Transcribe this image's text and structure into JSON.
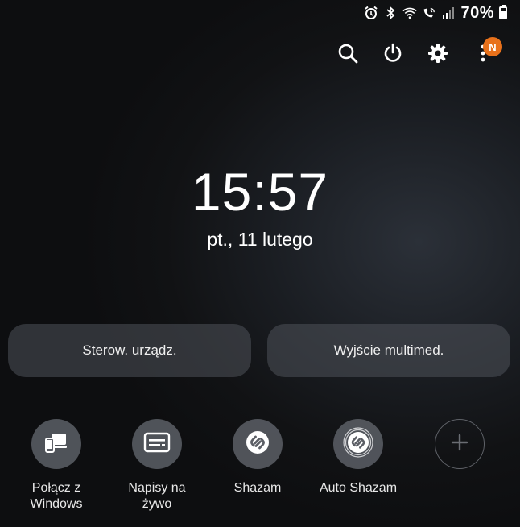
{
  "status_bar": {
    "icons": [
      "alarm-icon",
      "bluetooth-icon",
      "wifi-icon",
      "wifi-calling-icon",
      "signal-icon"
    ],
    "battery_text": "70%",
    "battery_level": 0.7
  },
  "top_actions": {
    "icons": [
      "search-icon",
      "power-icon",
      "gear-icon",
      "more-vertical-icon"
    ],
    "badge": "N",
    "badge_color": "#e8711b"
  },
  "clock": {
    "time": "15:57",
    "date": "pt., 11 lutego"
  },
  "buttons": {
    "device_control": "Sterow. urządz.",
    "media_output": "Wyjście multimed."
  },
  "tiles": {
    "link_windows_1": "Połącz z",
    "link_windows_2": "Windows",
    "live_caption_1": "Napisy na",
    "live_caption_2": "żywo",
    "shazam": "Shazam",
    "auto_shazam": "Auto Shazam"
  }
}
